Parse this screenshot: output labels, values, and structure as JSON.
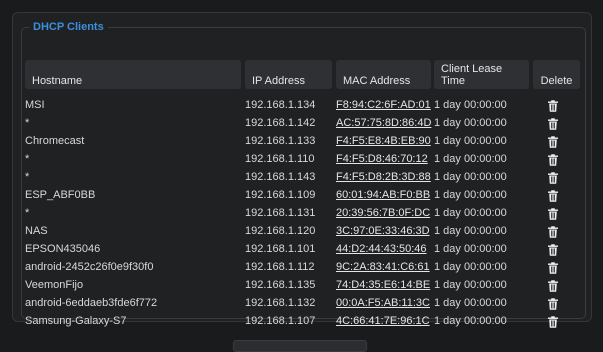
{
  "section": {
    "title": "DHCP Clients"
  },
  "table": {
    "headers": {
      "hostname": "Hostname",
      "ip": "IP Address",
      "mac": "MAC Address",
      "lease": "Client Lease Time",
      "delete": "Delete"
    },
    "rows": [
      {
        "hostname": "MSI",
        "ip": "192.168.1.134",
        "mac": "F8:94:C2:6F:AD:01",
        "lease": "1 day 00:00:00"
      },
      {
        "hostname": "*",
        "ip": "192.168.1.142",
        "mac": "AC:57:75:8D:86:4D",
        "lease": "1 day 00:00:00"
      },
      {
        "hostname": "Chromecast",
        "ip": "192.168.1.133",
        "mac": "F4:F5:E8:4B:EB:90",
        "lease": "1 day 00:00:00"
      },
      {
        "hostname": "*",
        "ip": "192.168.1.110",
        "mac": "F4:F5:D8:46:70:12",
        "lease": "1 day 00:00:00"
      },
      {
        "hostname": "*",
        "ip": "192.168.1.143",
        "mac": "F4:F5:D8:2B:3D:88",
        "lease": "1 day 00:00:00"
      },
      {
        "hostname": "ESP_ABF0BB",
        "ip": "192.168.1.109",
        "mac": "60:01:94:AB:F0:BB",
        "lease": "1 day 00:00:00"
      },
      {
        "hostname": "*",
        "ip": "192.168.1.131",
        "mac": "20:39:56:7B:0F:DC",
        "lease": "1 day 00:00:00"
      },
      {
        "hostname": "NAS",
        "ip": "192.168.1.120",
        "mac": "3C:97:0E:33:46:3D",
        "lease": "1 day 00:00:00"
      },
      {
        "hostname": "EPSON435046",
        "ip": "192.168.1.101",
        "mac": "44:D2:44:43:50:46",
        "lease": "1 day 00:00:00"
      },
      {
        "hostname": "android-2452c26f0e9f30f0",
        "ip": "192.168.1.112",
        "mac": "9C:2A:83:41:C6:61",
        "lease": "1 day 00:00:00"
      },
      {
        "hostname": "VeemonFijo",
        "ip": "192.168.1.135",
        "mac": "74:D4:35:E6:14:BE",
        "lease": "1 day 00:00:00"
      },
      {
        "hostname": "android-6eddaeb3fde6f772",
        "ip": "192.168.1.132",
        "mac": "00:0A:F5:AB:11:3C",
        "lease": "1 day 00:00:00"
      },
      {
        "hostname": "Samsung-Galaxy-S7",
        "ip": "192.168.1.107",
        "mac": "4C:66:41:7E:96:1C",
        "lease": "1 day 00:00:00"
      }
    ],
    "delete_icon": "trash-icon"
  },
  "colors": {
    "legend": "#3b8fdd",
    "background": "#1a1b1d",
    "panel": "#202123",
    "header": "#2e3033"
  }
}
